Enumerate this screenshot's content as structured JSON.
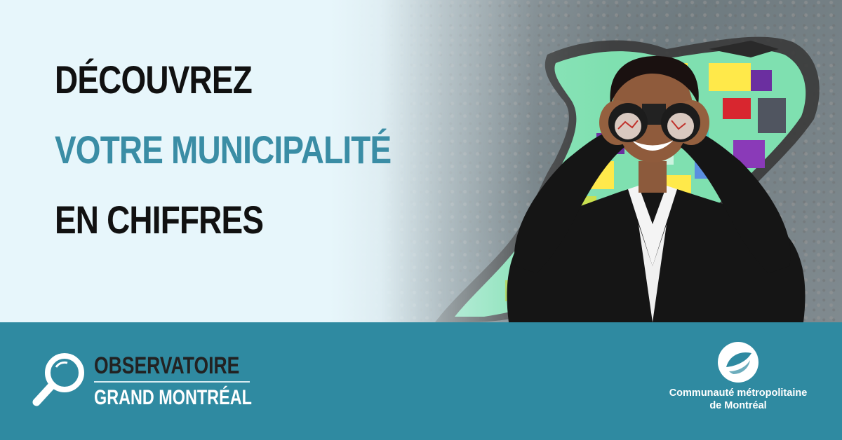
{
  "headline": {
    "line1": "DÉCOUVREZ",
    "line2": "VOTRE MUNICIPALITÉ",
    "line3": "EN CHIFFRES"
  },
  "colors": {
    "accent": "#3a8da5",
    "footer_bg": "#2f8aa1",
    "banner_bg": "#e7f6fb",
    "headline_text": "#111111"
  },
  "footer": {
    "observatoire": {
      "line1": "OBSERVATOIRE",
      "line2": "GRAND MONTRÉAL",
      "icon": "magnifier-icon"
    },
    "cmm": {
      "name_line1": "Communauté métropolitaine",
      "name_line2": "de Montréal",
      "icon": "cmm-emblem-icon"
    }
  }
}
